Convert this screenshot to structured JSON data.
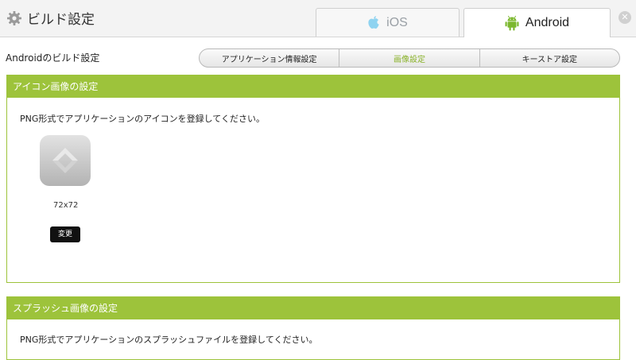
{
  "header": {
    "title": "ビルド設定",
    "tabs": [
      {
        "label": "iOS",
        "icon": "apple-icon",
        "active": false
      },
      {
        "label": "Android",
        "icon": "android-icon",
        "active": true
      }
    ],
    "close_icon": "close-icon"
  },
  "subheader": {
    "label": "Androidのビルド設定",
    "segments": [
      {
        "label": "アプリケーション情報設定",
        "active": false
      },
      {
        "label": "画像設定",
        "active": true
      },
      {
        "label": "キーストア設定",
        "active": false
      }
    ]
  },
  "icon_section": {
    "title": "アイコン画像の設定",
    "description": "PNG形式でアプリケーションのアイコンを登録してください。",
    "size_label": "72x72",
    "change_button": "変更"
  },
  "splash_section": {
    "title": "スプラッシュ画像の設定",
    "description": "PNG形式でアプリケーションのスプラッシュファイルを登録してください。"
  },
  "colors": {
    "accent_green": "#9dc33b",
    "active_segment_text": "#8ab22b",
    "ios_icon": "#8fd3f0",
    "android_icon": "#7cb82f"
  }
}
